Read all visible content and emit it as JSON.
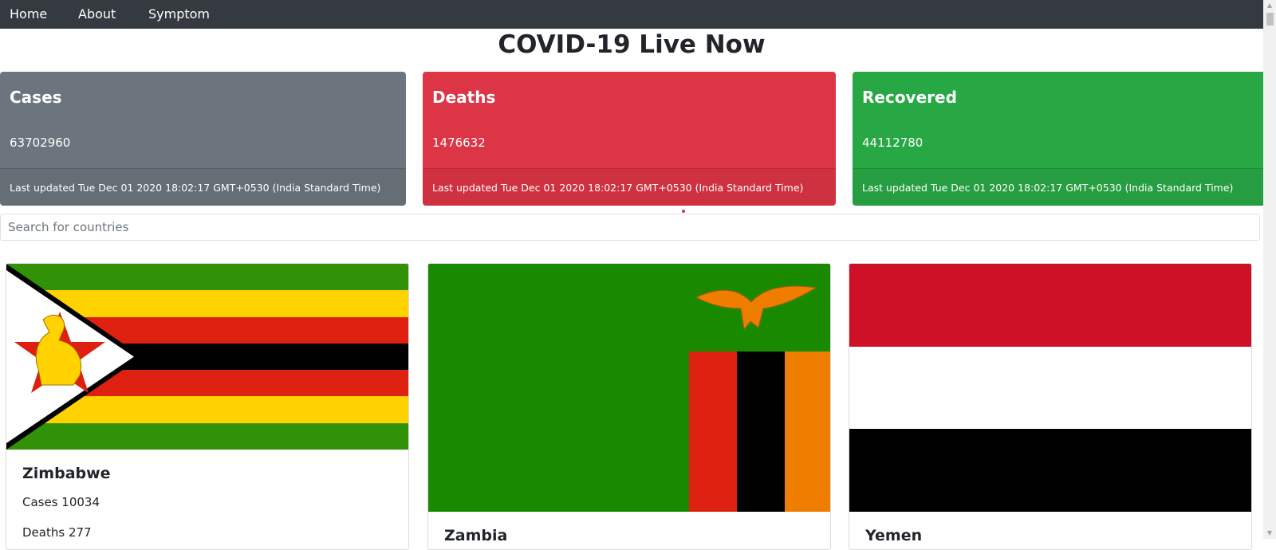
{
  "nav": {
    "items": [
      "Home",
      "About",
      "Symptom"
    ]
  },
  "page": {
    "title": "COVID-19 Live Now"
  },
  "stats": [
    {
      "title": "Cases",
      "value": "63702960",
      "updated": "Last updated Tue Dec 01 2020 18:02:17 GMT+0530 (India Standard Time)",
      "color": "#6c757d"
    },
    {
      "title": "Deaths",
      "value": "1476632",
      "updated": "Last updated Tue Dec 01 2020 18:02:17 GMT+0530 (India Standard Time)",
      "color": "#dc3545"
    },
    {
      "title": "Recovered",
      "value": "44112780",
      "updated": "Last updated Tue Dec 01 2020 18:02:17 GMT+0530 (India Standard Time)",
      "color": "#28a745"
    }
  ],
  "search": {
    "placeholder": "Search for countries"
  },
  "countries": [
    {
      "name": "Zimbabwe",
      "cases": "Cases 10034",
      "deaths": "Deaths 277"
    },
    {
      "name": "Zambia"
    },
    {
      "name": "Yemen"
    }
  ]
}
